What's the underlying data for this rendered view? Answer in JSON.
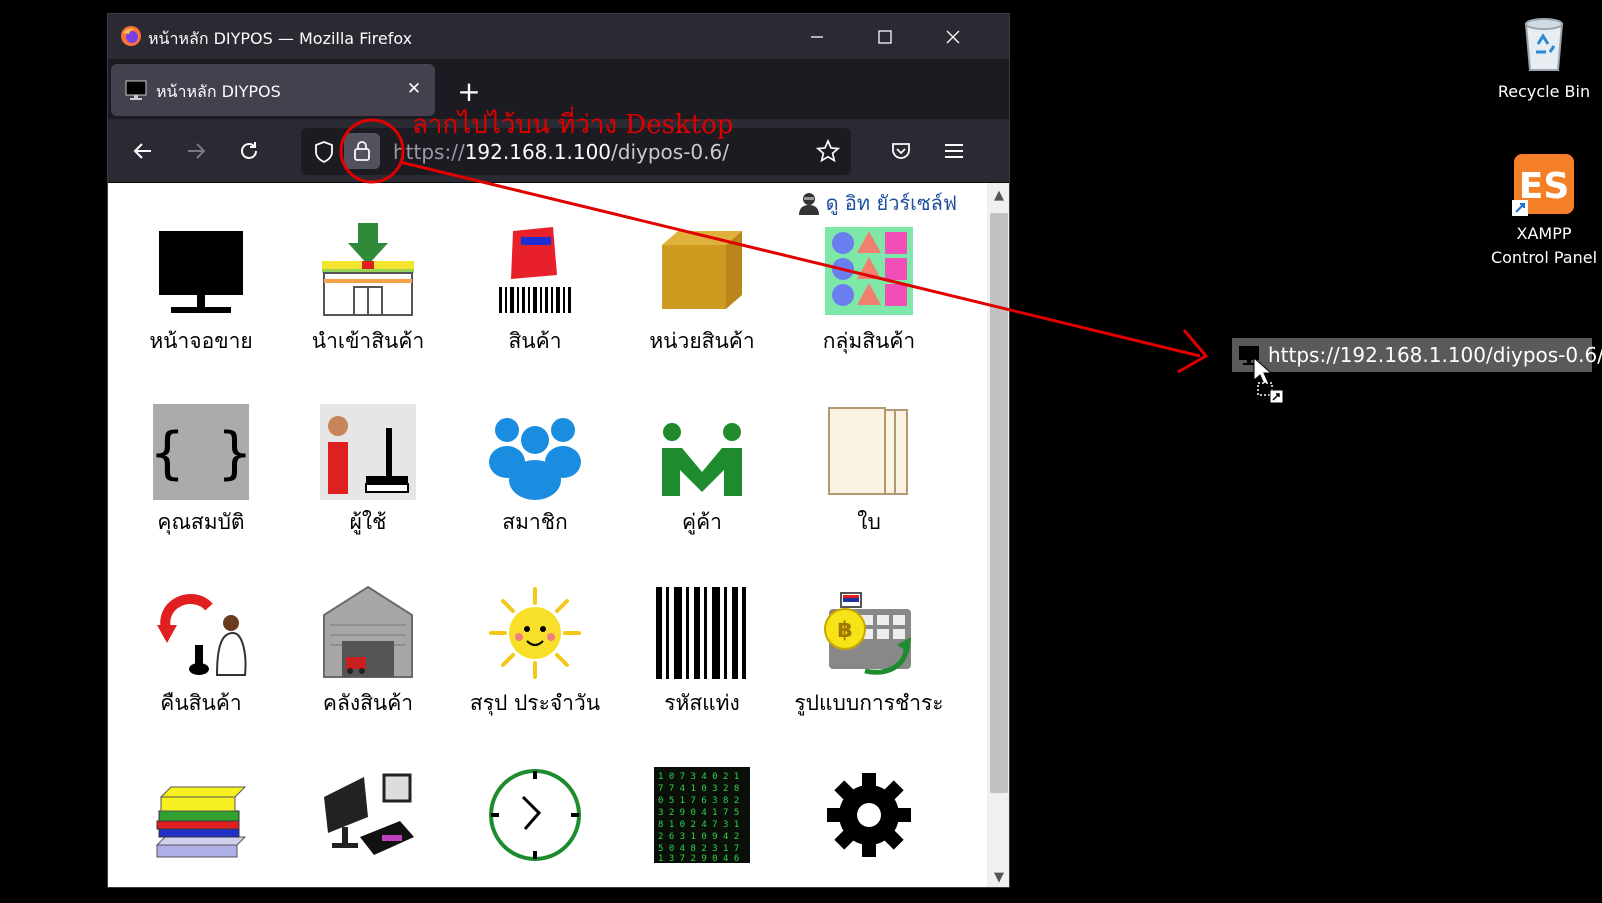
{
  "window": {
    "title": "หน้าหลัก DIYPOS — Mozilla Firefox",
    "controls": {
      "minimize": "—",
      "maximize": "☐",
      "close": "✕"
    }
  },
  "tab": {
    "title": "หน้าหลัก DIYPOS",
    "close": "✕",
    "new_tab": "+"
  },
  "urlbar": {
    "protocol": "https://",
    "host": "192.168.1.100",
    "path": "/diypos-0.6/"
  },
  "annotation": {
    "text": "ลากไปไว้บน ที่ว่าง Desktop",
    "color": "#e00000"
  },
  "page": {
    "user_name": "ดู อิท ยัวร์เซล์ฟ",
    "menu": [
      {
        "label": "หน้าจอขาย",
        "icon": "monitor-icon"
      },
      {
        "label": "นำเข้าสินค้า",
        "icon": "import-goods-icon"
      },
      {
        "label": "สินค้า",
        "icon": "product-barcode-icon"
      },
      {
        "label": "หน่วยสินค้า",
        "icon": "box-icon"
      },
      {
        "label": "กลุ่มสินค้า",
        "icon": "shapes-group-icon"
      },
      {
        "label": "คุณสมบัติ",
        "icon": "braces-icon"
      },
      {
        "label": "ผู้ใช้",
        "icon": "user-computer-icon"
      },
      {
        "label": "สมาชิก",
        "icon": "members-icon"
      },
      {
        "label": "คู่ค้า",
        "icon": "partner-m-icon"
      },
      {
        "label": "ใบ",
        "icon": "documents-icon"
      },
      {
        "label": "คืนสินค้า",
        "icon": "return-goods-icon"
      },
      {
        "label": "คลังสินค้า",
        "icon": "warehouse-icon"
      },
      {
        "label": "สรุป ประจำวัน",
        "icon": "sun-icon"
      },
      {
        "label": "รหัสแท่ง",
        "icon": "barcode-icon"
      },
      {
        "label": "รูปแบบการชำระ",
        "icon": "payment-icon"
      },
      {
        "label": "",
        "icon": "books-icon"
      },
      {
        "label": "",
        "icon": "devices-icon"
      },
      {
        "label": "",
        "icon": "clock-icon"
      },
      {
        "label": "",
        "icon": "matrix-code-icon"
      },
      {
        "label": "",
        "icon": "gear-icon"
      }
    ]
  },
  "desktop": {
    "recycle_bin": "Recycle Bin",
    "xampp_line1": "XAMPP",
    "xampp_line2": "Control Panel",
    "drag_url": "https://192.168.1.100/diypos-0.6/"
  }
}
